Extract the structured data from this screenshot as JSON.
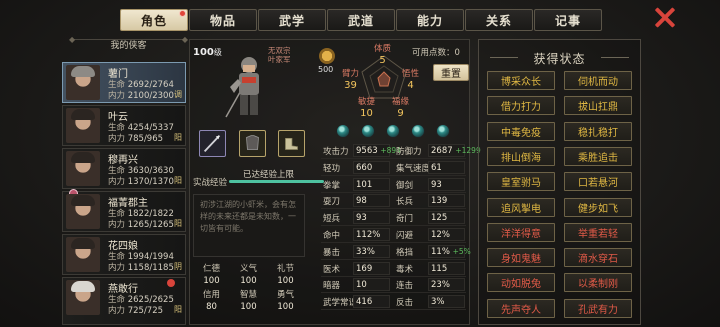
{
  "tabs": [
    "角色",
    "物品",
    "武学",
    "武道",
    "能力",
    "关系",
    "记事"
  ],
  "list": {
    "header": "我的侠客",
    "characters": [
      {
        "name": "薯门",
        "hp_label": "生命",
        "hp": "2692/2764",
        "mp_label": "内力",
        "mp": "2100/2300",
        "tag": "调"
      },
      {
        "name": "叶云",
        "hp_label": "生命",
        "hp": "4254/5337",
        "mp_label": "内力",
        "mp": "785/965",
        "tag": "阳"
      },
      {
        "name": "穆再兴",
        "hp_label": "生命",
        "hp": "3630/3630",
        "mp_label": "内力",
        "mp": "1370/1370",
        "tag": "阳"
      },
      {
        "name": "福菁郡主",
        "hp_label": "生命",
        "hp": "1822/1822",
        "mp_label": "内力",
        "mp": "1265/1265",
        "tag": "阳"
      },
      {
        "name": "花四娘",
        "hp_label": "生命",
        "hp": "1994/1994",
        "mp_label": "内力",
        "mp": "1158/1185",
        "tag": "阴"
      },
      {
        "name": "燕敢行",
        "hp_label": "生命",
        "hp": "2625/2625",
        "mp_label": "内力",
        "mp": "725/725",
        "tag": "阳"
      }
    ]
  },
  "detail": {
    "level": "100",
    "level_unit": "级",
    "sect_1": "无双宗",
    "sect_2": "叶家军",
    "potential": "500",
    "points_label": "可用点数：",
    "points": "0",
    "reset": "重置",
    "attrs": {
      "tizhi": {
        "name": "体质",
        "value": "5"
      },
      "biji": {
        "name": "臂力",
        "value": "39"
      },
      "wuxing": {
        "name": "悟性",
        "value": "4"
      },
      "minjie": {
        "name": "敏捷",
        "value": "10"
      },
      "fuyuan": {
        "name": "福缘",
        "value": "9"
      }
    },
    "exp_label": "实战经验",
    "exp_text": "已达经验上限",
    "exp_progress": 1.0,
    "bio": "初涉江湖的小虾米，会有怎样的未来还都是未知数，一切皆有可能。",
    "virtues": [
      {
        "k": "仁德",
        "v": "100"
      },
      {
        "k": "义气",
        "v": "100"
      },
      {
        "k": "礼节",
        "v": "100"
      },
      {
        "k": "信用",
        "v": "80"
      },
      {
        "k": "智慧",
        "v": "100"
      },
      {
        "k": "勇气",
        "v": "100"
      }
    ],
    "stats": [
      {
        "k": "攻击力",
        "v": "9563",
        "plus": "+894",
        "k2": "防御力",
        "v2": "2687",
        "plus2": "+1299"
      },
      {
        "k": "轻功",
        "v": "660",
        "k2": "集气速度",
        "v2": "61"
      },
      {
        "k": "拳掌",
        "v": "101",
        "k2": "御剑",
        "v2": "93"
      },
      {
        "k": "耍刀",
        "v": "98",
        "k2": "长兵",
        "v2": "139"
      },
      {
        "k": "短兵",
        "v": "93",
        "k2": "奇门",
        "v2": "125"
      },
      {
        "k": "命中",
        "v": "112%",
        "k2": "闪避",
        "v2": "12%"
      },
      {
        "k": "暴击",
        "v": "33%",
        "k2": "格挡",
        "v2": "11%",
        "plus2": "+5%"
      },
      {
        "k": "医术",
        "v": "169",
        "k2": "毒术",
        "v2": "115"
      },
      {
        "k": "暗器",
        "v": "10",
        "k2": "连击",
        "v2": "23%"
      },
      {
        "k": "武学常识",
        "v": "416",
        "k2": "反击",
        "v2": "3%"
      }
    ]
  },
  "status": {
    "title": "获得状态",
    "items": [
      {
        "t": "博采众长",
        "c": "gold"
      },
      {
        "t": "伺机而动",
        "c": "gold"
      },
      {
        "t": "借力打力",
        "c": "gold"
      },
      {
        "t": "拔山扛鼎",
        "c": "gold"
      },
      {
        "t": "中毒免疫",
        "c": "gold"
      },
      {
        "t": "稳扎稳打",
        "c": "gold"
      },
      {
        "t": "排山倒海",
        "c": "gold"
      },
      {
        "t": "乘胜追击",
        "c": "gold"
      },
      {
        "t": "皇室驸马",
        "c": "gold"
      },
      {
        "t": "口若悬河",
        "c": "gold"
      },
      {
        "t": "追风掣电",
        "c": "gold"
      },
      {
        "t": "健步如飞",
        "c": "gold"
      },
      {
        "t": "洋洋得意",
        "c": "red"
      },
      {
        "t": "举重若轻",
        "c": "red"
      },
      {
        "t": "身如鬼魅",
        "c": "red"
      },
      {
        "t": "滴水穿石",
        "c": "red"
      },
      {
        "t": "动如脱兔",
        "c": "red"
      },
      {
        "t": "以柔制刚",
        "c": "red"
      },
      {
        "t": "先声夺人",
        "c": "red"
      },
      {
        "t": "孔武有力",
        "c": "red"
      }
    ]
  },
  "colors": {
    "gold": "#e0b843",
    "red": "#e15a48",
    "accent": "#4ec2a0"
  }
}
